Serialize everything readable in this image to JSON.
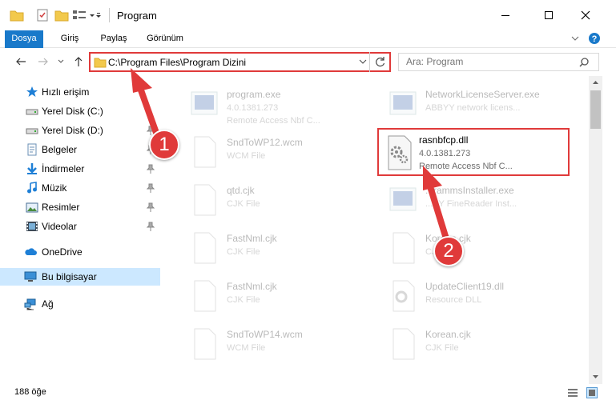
{
  "window": {
    "title": "Program"
  },
  "ribbon": {
    "tabs": [
      {
        "label": "Dosya"
      },
      {
        "label": "Giriş"
      },
      {
        "label": "Paylaş"
      },
      {
        "label": "Görünüm"
      }
    ]
  },
  "address": {
    "path": "C:\\Program Files\\Program Dizini"
  },
  "search": {
    "placeholder": "Ara: Program"
  },
  "nav": {
    "items": [
      {
        "label": "Hızlı erişim",
        "icon": "star-icon"
      },
      {
        "label": "Yerel Disk (C:)",
        "icon": "drive-icon"
      },
      {
        "label": "Yerel Disk (D:)",
        "icon": "drive-icon"
      },
      {
        "label": "Belgeler",
        "icon": "documents-icon"
      },
      {
        "label": "İndirmeler",
        "icon": "download-icon"
      },
      {
        "label": "Müzik",
        "icon": "music-icon"
      },
      {
        "label": "Resimler",
        "icon": "pictures-icon"
      },
      {
        "label": "Videolar",
        "icon": "videos-icon"
      },
      {
        "label": "OneDrive",
        "icon": "cloud-icon"
      },
      {
        "label": "Bu bilgisayar",
        "icon": "computer-icon"
      },
      {
        "label": "Ağ",
        "icon": "network-icon"
      }
    ]
  },
  "files": [
    {
      "name": "program.exe",
      "line2": "4.0.1381.273",
      "line3": "Remote Access Nbf C...",
      "type": "exe"
    },
    {
      "name": "NetworkLicenseServer.exe",
      "line2": "ABBYY network licens...",
      "line3": "",
      "type": "exe"
    },
    {
      "name": "SndToWP12.wcm",
      "line2": "WCM File",
      "line3": "",
      "type": "doc"
    },
    {
      "name": "rasnbfcp.dll",
      "line2": "4.0.1381.273",
      "line3": "Remote Access Nbf C...",
      "type": "dll"
    },
    {
      "name": "qtd.cjk",
      "line2": "CJK File",
      "line3": "",
      "type": "doc"
    },
    {
      "name": "...rammsInstaller.exe",
      "line2": "...YY FineReader Inst...",
      "line3": "",
      "type": "exe"
    },
    {
      "name": "FastNml.cjk",
      "line2": "CJK File",
      "line3": "",
      "type": "doc"
    },
    {
      "name": "Korean.cjk",
      "line2": "CJK File",
      "line3": "",
      "type": "doc"
    },
    {
      "name": "FastNml.cjk",
      "line2": "CJK File",
      "line3": "",
      "type": "doc"
    },
    {
      "name": "UpdateClient19.dll",
      "line2": "Resource DLL",
      "line3": "",
      "type": "dll"
    },
    {
      "name": "SndToWP14.wcm",
      "line2": "WCM File",
      "line3": "",
      "type": "doc"
    },
    {
      "name": "Korean.cjk",
      "line2": "CJK File",
      "line3": "",
      "type": "doc"
    }
  ],
  "status": {
    "count": "188 öğe"
  },
  "annotations": {
    "badge1": "1",
    "badge2": "2"
  },
  "colors": {
    "accent": "#1979ca",
    "highlight": "#e03a3a",
    "selection": "#cce8ff"
  }
}
